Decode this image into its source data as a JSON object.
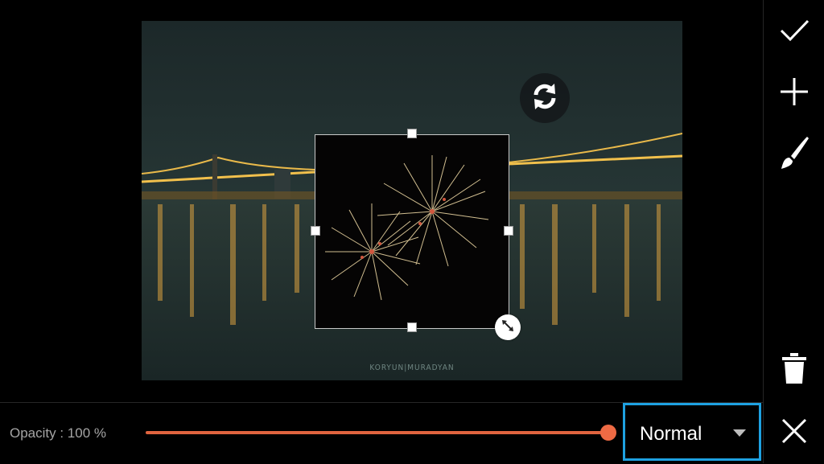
{
  "editor": {
    "photo_watermark": "KORYUN|MURADYAN",
    "rotate_icon": "rotate-icon",
    "resize_icon": "resize-diagonal-icon"
  },
  "toolbar": {
    "apply_icon": "checkmark-icon",
    "add_icon": "plus-icon",
    "brush_icon": "brush-icon",
    "delete_icon": "trash-icon",
    "close_icon": "close-icon"
  },
  "bottom_bar": {
    "opacity_label": "Opacity : 100 %",
    "opacity_value": 1.0,
    "blend_mode": "Normal",
    "blend_dropdown_icon": "caret-down-icon"
  },
  "colors": {
    "accent_slider": "#e0643f",
    "selection_border": "#1ea1e1"
  }
}
